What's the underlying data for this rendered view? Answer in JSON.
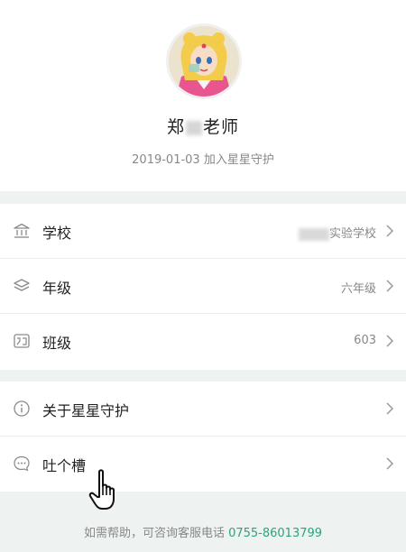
{
  "profile": {
    "name_prefix": "郑",
    "name_suffix": "老师",
    "join_text": "2019-01-03 加入星星守护"
  },
  "info_rows": [
    {
      "icon": "school-icon",
      "label": "学校",
      "value": "实验学校"
    },
    {
      "icon": "layers-icon",
      "label": "年级",
      "value": "六年级"
    },
    {
      "icon": "class-icon",
      "label": "班级",
      "value": "603"
    }
  ],
  "action_rows": [
    {
      "icon": "info-icon",
      "label": "关于星星守护"
    },
    {
      "icon": "chat-bubble-icon",
      "label": "吐个槽"
    }
  ],
  "footer": {
    "help_text": "如需帮助，可咨询客服电话",
    "phone": "0755-86013799"
  },
  "colors": {
    "accent": "#2aa57a",
    "background": "#eef2f1",
    "secondary_text": "#888888"
  }
}
